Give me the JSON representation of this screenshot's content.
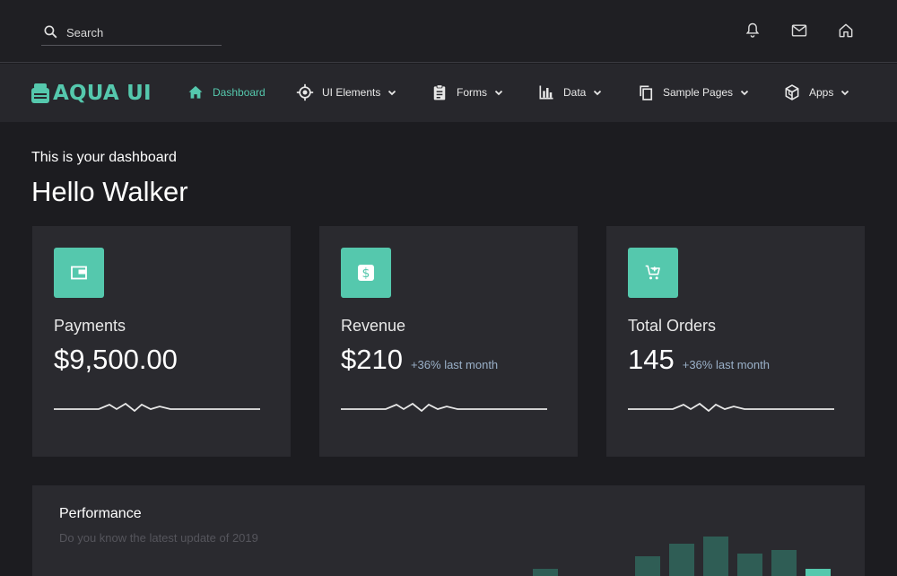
{
  "search": {
    "placeholder": "Search"
  },
  "topbar": {
    "icons": [
      "bell-icon",
      "mail-icon",
      "home-icon"
    ]
  },
  "brand": {
    "name": "AQUA UI"
  },
  "nav": [
    {
      "label": "Dashboard",
      "icon": "home-icon",
      "active": true
    },
    {
      "label": "UI Elements",
      "icon": "crosshair-icon"
    },
    {
      "label": "Forms",
      "icon": "clipboard-icon"
    },
    {
      "label": "Data",
      "icon": "bar-chart-icon"
    },
    {
      "label": "Sample Pages",
      "icon": "copy-icon"
    },
    {
      "label": "Apps",
      "icon": "cube-icon"
    }
  ],
  "greeting": {
    "subtitle": "This is your dashboard",
    "title": "Hello Walker"
  },
  "cards": [
    {
      "label": "Payments",
      "value": "$9,500.00",
      "delta": "",
      "icon": "wallet-icon"
    },
    {
      "label": "Revenue",
      "value": "$210",
      "delta": "+36% last month",
      "icon": "dollar-icon"
    },
    {
      "label": "Total Orders",
      "value": "145",
      "delta": "+36% last month",
      "icon": "cart-add-icon"
    }
  ],
  "performance": {
    "title": "Performance",
    "subtitle": "Do you know the latest update of 2019",
    "bar_levels": [
      0.16,
      0.44,
      0.73,
      0.9,
      0.5,
      0.6,
      0.16
    ]
  },
  "colors": {
    "accent": "#55c8ad",
    "background": "#1c1c20",
    "card": "#2a2a2f",
    "delta": "#9ab0c8"
  }
}
